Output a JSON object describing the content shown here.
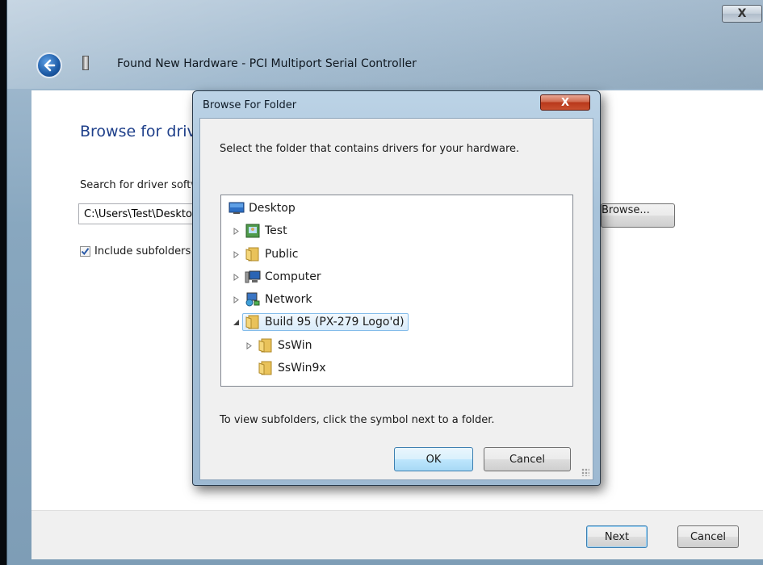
{
  "wizard": {
    "title": "Found New Hardware - PCI Multiport Serial Controller",
    "close_glyph": "X",
    "heading": "Browse for driver software on your computer",
    "search_label": "Search for driver software in this location:",
    "path_value": "C:\\Users\\Test\\Desktop",
    "browse_label": "Browse...",
    "include_subfolders_label": "Include subfolders",
    "include_subfolders_checked": true,
    "next_label": "Next",
    "cancel_label": "Cancel"
  },
  "dialog": {
    "title": "Browse For Folder",
    "close_glyph": "X",
    "instruction": "Select the folder that contains drivers for your hardware.",
    "tree": [
      {
        "label": "Desktop",
        "icon": "desktop-icon",
        "expander": "none",
        "selected": false
      },
      {
        "label": "Test",
        "icon": "user-folder-icon",
        "expander": "collapsed",
        "selected": false
      },
      {
        "label": "Public",
        "icon": "folder-icon",
        "expander": "collapsed",
        "selected": false
      },
      {
        "label": "Computer",
        "icon": "computer-icon",
        "expander": "collapsed",
        "selected": false
      },
      {
        "label": "Network",
        "icon": "network-icon",
        "expander": "collapsed",
        "selected": false
      },
      {
        "label": "Build 95 (PX-279 Logo'd)",
        "icon": "folder-icon",
        "expander": "expanded",
        "selected": true
      },
      {
        "label": "SsWin",
        "icon": "folder-icon",
        "expander": "collapsed",
        "selected": false
      },
      {
        "label": "SsWin9x",
        "icon": "folder-icon",
        "expander": "none",
        "selected": false
      }
    ],
    "hint": "To view subfolders, click the symbol next to a folder.",
    "ok_label": "OK",
    "cancel_label": "Cancel"
  },
  "colors": {
    "heading_blue": "#1e3f8a",
    "close_red": "#c9502f",
    "selection_border": "#84bcea"
  }
}
